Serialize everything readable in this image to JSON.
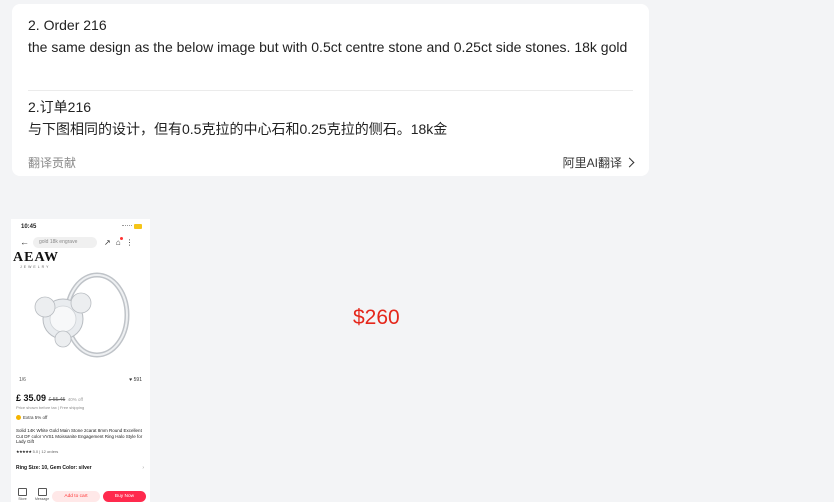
{
  "message_card": {
    "original_heading": "2. Order 216",
    "original_text": "the same design as the below image but with 0.5ct centre stone and 0.25ct side stones. 18k gold",
    "translated_heading": "2.订单216",
    "translated_text": "与下图相同的设计，但有0.5克拉的中心石和0.25克拉的侧石。18k金",
    "footer_left": "翻译贡献",
    "footer_right": "阿里AI翻译"
  },
  "product_screenshot": {
    "time": "10:45",
    "search_placeholder": "gold 18k engrave",
    "brand": "AEAW",
    "brand_sub": "JEWELRY",
    "image_counter": "1/6",
    "likes": "591",
    "price": "£ 35.09",
    "old_price": "£ 55.45",
    "discount": "40% off",
    "tax_note": "Price shown before tax | Free shipping",
    "coins": "Extra 5% off",
    "description": "Solid 14K White Gold Main Stone 2carat 8mm Round Excellent Cut DF color VVS1 Moissanite Engagement Ring Halo Style for Lady Gift",
    "rating_stars": "★★★★★",
    "rating": "5.0 | 12 orders",
    "options": "Ring Size: 10, Gem Color: silver",
    "store_label": "Store",
    "message_label": "Message",
    "add_to_cart": "Add to cart",
    "buy_now": "Buy Now"
  },
  "price_label": "$260"
}
